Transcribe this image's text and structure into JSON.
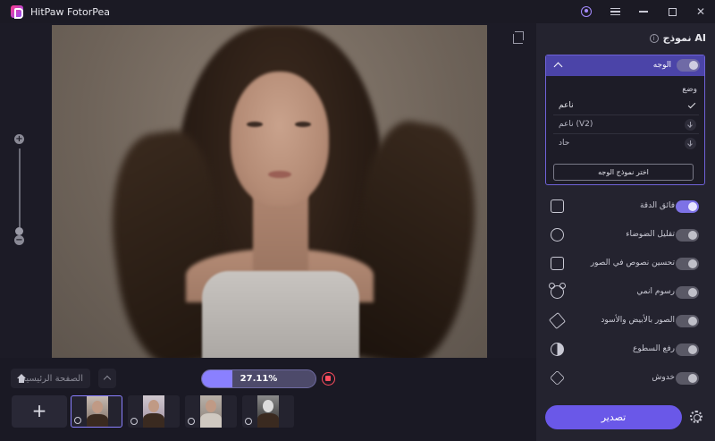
{
  "app": {
    "title": "HitPaw FotorPea"
  },
  "bottombar": {
    "home_label": "الصفحة الرئيسية",
    "progress_text": "27.11%",
    "progress_fraction": 0.2711,
    "add_label": "+"
  },
  "panel": {
    "title": "نموذج AI",
    "info": "i",
    "face": {
      "label": "الوجه",
      "enabled": true,
      "mode_label": "وضع",
      "modes": [
        {
          "label": "ناعم",
          "state": "selected"
        },
        {
          "label": "ناعم (V2)",
          "state": "download"
        },
        {
          "label": "حاد",
          "state": "download"
        }
      ],
      "pick_button": "اختر نموذج الوجه"
    },
    "features": [
      {
        "label": "فائق الدقة",
        "icon": "upscale-icon",
        "enabled": true
      },
      {
        "label": "تقليل الضوضاء",
        "icon": "denoise-icon",
        "enabled": false
      },
      {
        "label": "تحسين نصوص في الصور",
        "icon": "text-enhance-icon",
        "enabled": false
      },
      {
        "label": "رسوم انمي",
        "icon": "anime-icon",
        "enabled": false
      },
      {
        "label": "الصور بالأبيض والأسود",
        "icon": "colorize-icon",
        "enabled": false
      },
      {
        "label": "رفع السطوع",
        "icon": "brightness-icon",
        "enabled": false
      },
      {
        "label": "خدوش",
        "icon": "scratch-icon",
        "enabled": false
      }
    ],
    "export_label": "تصدير"
  },
  "colors": {
    "accent": "#6a58e8",
    "stop": "#ff4d5e"
  }
}
